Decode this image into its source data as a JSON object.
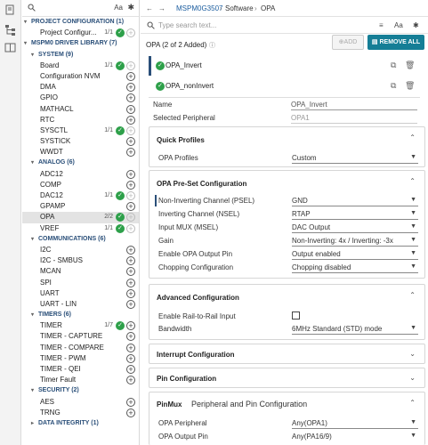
{
  "rail": {
    "icons": [
      "files-icon",
      "hierarchy-icon",
      "book-icon"
    ]
  },
  "left": {
    "search_placeholder": "",
    "aa": "Aa",
    "tree": [
      {
        "kind": "sec",
        "label": "PROJECT CONFIGURATION (1)",
        "depth": 0,
        "open": true
      },
      {
        "kind": "item",
        "label": "Project Configur...",
        "count": "1/1",
        "ok": true,
        "add": "dim",
        "depth": 1
      },
      {
        "kind": "sec",
        "label": "MSPM0 DRIVER LIBRARY (7)",
        "depth": 0,
        "open": true
      },
      {
        "kind": "sec",
        "label": "SYSTEM (9)",
        "depth": 1,
        "open": true
      },
      {
        "kind": "item",
        "label": "Board",
        "count": "1/1",
        "ok": true,
        "add": "dim",
        "depth": 2
      },
      {
        "kind": "item",
        "label": "Configuration NVM",
        "count": "",
        "ok": false,
        "add": "on",
        "depth": 2
      },
      {
        "kind": "item",
        "label": "DMA",
        "count": "",
        "ok": false,
        "add": "on",
        "depth": 2
      },
      {
        "kind": "item",
        "label": "GPIO",
        "count": "",
        "ok": false,
        "add": "on",
        "depth": 2
      },
      {
        "kind": "item",
        "label": "MATHACL",
        "count": "",
        "ok": false,
        "add": "on",
        "depth": 2
      },
      {
        "kind": "item",
        "label": "RTC",
        "count": "",
        "ok": false,
        "add": "on",
        "depth": 2
      },
      {
        "kind": "item",
        "label": "SYSCTL",
        "count": "1/1",
        "ok": true,
        "add": "dim",
        "depth": 2
      },
      {
        "kind": "item",
        "label": "SYSTICK",
        "count": "",
        "ok": false,
        "add": "on",
        "depth": 2
      },
      {
        "kind": "item",
        "label": "WWDT",
        "count": "",
        "ok": false,
        "add": "on",
        "depth": 2
      },
      {
        "kind": "sec",
        "label": "ANALOG (6)",
        "depth": 1,
        "open": true
      },
      {
        "kind": "item",
        "label": "ADC12",
        "count": "",
        "ok": false,
        "add": "on",
        "depth": 2
      },
      {
        "kind": "item",
        "label": "COMP",
        "count": "",
        "ok": false,
        "add": "on",
        "depth": 2
      },
      {
        "kind": "item",
        "label": "DAC12",
        "count": "1/1",
        "ok": true,
        "add": "dim",
        "depth": 2
      },
      {
        "kind": "item",
        "label": "GPAMP",
        "count": "",
        "ok": false,
        "add": "on",
        "depth": 2
      },
      {
        "kind": "item",
        "label": "OPA",
        "count": "2/2",
        "ok": true,
        "add": "dim",
        "depth": 2,
        "selected": true
      },
      {
        "kind": "item",
        "label": "VREF",
        "count": "1/1",
        "ok": true,
        "add": "dim",
        "depth": 2
      },
      {
        "kind": "sec",
        "label": "COMMUNICATIONS (6)",
        "depth": 1,
        "open": true
      },
      {
        "kind": "item",
        "label": "I2C",
        "count": "",
        "ok": false,
        "add": "on",
        "depth": 2
      },
      {
        "kind": "item",
        "label": "I2C - SMBUS",
        "count": "",
        "ok": false,
        "add": "on",
        "depth": 2
      },
      {
        "kind": "item",
        "label": "MCAN",
        "count": "",
        "ok": false,
        "add": "on",
        "depth": 2
      },
      {
        "kind": "item",
        "label": "SPI",
        "count": "",
        "ok": false,
        "add": "on",
        "depth": 2
      },
      {
        "kind": "item",
        "label": "UART",
        "count": "",
        "ok": false,
        "add": "on",
        "depth": 2
      },
      {
        "kind": "item",
        "label": "UART - LIN",
        "count": "",
        "ok": false,
        "add": "on",
        "depth": 2
      },
      {
        "kind": "sec",
        "label": "TIMERS (6)",
        "depth": 1,
        "open": true
      },
      {
        "kind": "item",
        "label": "TIMER",
        "count": "1/7",
        "ok": true,
        "add": "on",
        "depth": 2
      },
      {
        "kind": "item",
        "label": "TIMER - CAPTURE",
        "count": "",
        "ok": false,
        "add": "on",
        "depth": 2
      },
      {
        "kind": "item",
        "label": "TIMER - COMPARE",
        "count": "",
        "ok": false,
        "add": "on",
        "depth": 2
      },
      {
        "kind": "item",
        "label": "TIMER - PWM",
        "count": "",
        "ok": false,
        "add": "on",
        "depth": 2
      },
      {
        "kind": "item",
        "label": "TIMER - QEI",
        "count": "",
        "ok": false,
        "add": "on",
        "depth": 2
      },
      {
        "kind": "item",
        "label": "Timer Fault",
        "count": "",
        "ok": false,
        "add": "on",
        "depth": 2
      },
      {
        "kind": "sec",
        "label": "SECURITY (2)",
        "depth": 1,
        "open": true
      },
      {
        "kind": "item",
        "label": "AES",
        "count": "",
        "ok": false,
        "add": "on",
        "depth": 2
      },
      {
        "kind": "item",
        "label": "TRNG",
        "count": "",
        "ok": false,
        "add": "on",
        "depth": 2
      },
      {
        "kind": "sec",
        "label": "DATA INTEGRITY (1)",
        "depth": 1,
        "open": false
      }
    ]
  },
  "breadcrumb": {
    "device": "MSPM0G3507",
    "sep1": "›",
    "category": "Software",
    "sep2": "›",
    "module": "OPA"
  },
  "topsearch": {
    "placeholder": "Type search text...",
    "aa": "Aa"
  },
  "header": {
    "title": "OPA (2 of 2 Added)",
    "add_label": "ADD",
    "remove_label": "REMOVE ALL"
  },
  "instances": [
    {
      "name": "OPA_Invert"
    },
    {
      "name": "OPA_nonInvert"
    }
  ],
  "name_field": {
    "label": "Name",
    "value": "OPA_Invert"
  },
  "periph_field": {
    "label": "Selected Peripheral",
    "value": "OPA1"
  },
  "quick_profiles": {
    "title": "Quick Profiles",
    "rows": [
      {
        "label": "OPA Profiles",
        "value": "Custom"
      }
    ]
  },
  "preset": {
    "title": "OPA Pre-Set Configuration",
    "rows": [
      {
        "label": "Non-Inverting Channel (PSEL)",
        "value": "GND"
      },
      {
        "label": "Inverting Channel (NSEL)",
        "value": "RTAP"
      },
      {
        "label": "Input MUX (MSEL)",
        "value": "DAC Output"
      },
      {
        "label": "Gain",
        "value": "Non-Inverting: 4x / Inverting: -3x"
      },
      {
        "label": "Enable OPA Output Pin",
        "value": "Output enabled"
      },
      {
        "label": "Chopping Configuration",
        "value": "Chopping disabled"
      }
    ]
  },
  "advanced": {
    "title": "Advanced Configuration",
    "rail_label": "Enable Rail-to-Rail Input",
    "bw_label": "Bandwidth",
    "bw_value": "6MHz Standard (STD) mode"
  },
  "interrupt": {
    "title": "Interrupt Configuration"
  },
  "pin": {
    "title": "Pin Configuration"
  },
  "pinmux": {
    "title": "PinMux",
    "subtitle": "Peripheral and Pin Configuration",
    "rows": [
      {
        "label": "OPA Peripheral",
        "value": "Any(OPA1)"
      },
      {
        "label": "OPA Output Pin",
        "value": "Any(PA16/9)"
      }
    ]
  },
  "colors": {
    "accent": "#157e96",
    "ok": "#2ea04a",
    "section": "#2a4f79"
  }
}
